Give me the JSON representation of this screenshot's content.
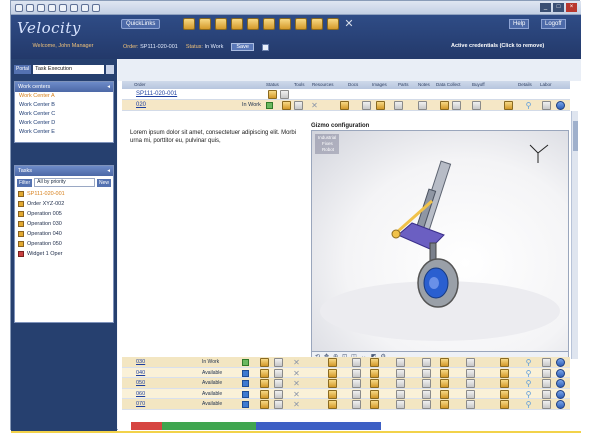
{
  "app": {
    "logo": "Velocity",
    "subtitle": "Welcome, John Manager",
    "quicklinks_label": "QuickLinks",
    "help_label": "Help",
    "logoff_label": "Logoff",
    "credentials_text": "Active credentials (Click to remove)"
  },
  "context": {
    "order_label": "Order:",
    "order_value": "SP111-020-001",
    "status_label": "Status:",
    "status_value": "In Work",
    "save_label": "Save"
  },
  "sidebar": {
    "portal_label": "Portal",
    "portal_value": "Task Execution",
    "work_centers_title": "Work centers",
    "work_centers": [
      "Work Center A",
      "Work Center B",
      "Work Center C",
      "Work Center D",
      "Work Center E"
    ],
    "tasks_title": "Tasks",
    "filter_label": "Filter",
    "filter_value": "All by priority",
    "filter_new_label": "New",
    "tasks": [
      {
        "label": "SP111-020-001",
        "icon": "task-icon",
        "active": true
      },
      {
        "label": "Order XYZ-002",
        "icon": "task-icon",
        "active": false
      },
      {
        "label": "Operation 005",
        "icon": "task-icon",
        "active": false
      },
      {
        "label": "Operation 030",
        "icon": "task-icon",
        "active": false
      },
      {
        "label": "Operation 040",
        "icon": "task-icon",
        "active": false
      },
      {
        "label": "Operation 050",
        "icon": "task-icon",
        "active": false
      },
      {
        "label": "Widget 1 Oper",
        "icon": "warning-icon",
        "active": false
      }
    ]
  },
  "grid": {
    "headers": [
      "Order",
      "Status",
      "Tools",
      "Resources",
      "Docs",
      "Images",
      "Parts",
      "Notes",
      "Data Collect",
      "Buyoff",
      "Details",
      "Labor"
    ],
    "order_row": {
      "link": "SP111-020-001"
    },
    "current_op": {
      "link": "020",
      "status": "In Work"
    }
  },
  "description": "Lorem ipsum dolor sit amet, consectetuer adipiscing elit. Morbi urna mi, porttitor eu, pulvinar quis,",
  "gizmo": {
    "title": "Gizmo configuration",
    "tree": [
      "Industrial",
      "Fixes",
      "Robot"
    ]
  },
  "operations": [
    {
      "link": "030",
      "status": "In Work",
      "indicator": "green"
    },
    {
      "link": "040",
      "status": "Available",
      "indicator": "blue"
    },
    {
      "link": "050",
      "status": "Available",
      "indicator": "blue"
    },
    {
      "link": "060",
      "status": "Available",
      "indicator": "blue"
    },
    {
      "link": "070",
      "status": "Available",
      "indicator": "blue"
    }
  ],
  "taskbar_colors": [
    "#d64541",
    "#3fa54f",
    "#3fa54f",
    "#3fa54f",
    "#3d5fc4",
    "#3d5fc4",
    "#3d5fc4",
    "#3d5fc4"
  ],
  "colors": {
    "header": "#2f4c86",
    "sidebar": "#26406f",
    "active_link": "#d7801c",
    "row_highlight": "#f5e7c6"
  }
}
